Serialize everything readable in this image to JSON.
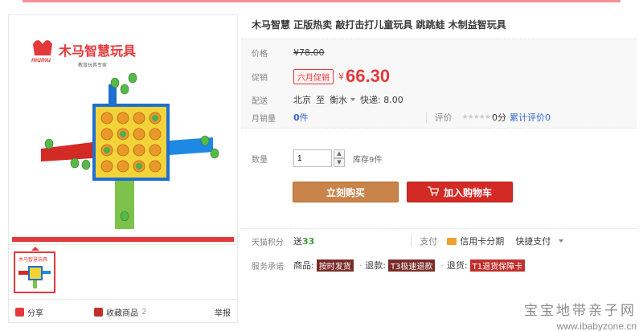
{
  "colors": {
    "accent": "#e4393c",
    "buy": "#c8844a",
    "cart": "#d42a26",
    "link": "#3366cc",
    "points": "#3a9a3a"
  },
  "product": {
    "title": "木马智慧 正版热卖 敲打击打儿童玩具 跳跳蛙 木制益智玩具",
    "image_logo": "木马智慧玩具",
    "image_logo_sub": "教育玩具专家",
    "image_brand": "mumu"
  },
  "price": {
    "label": "价格",
    "original": "¥78.00",
    "promo_label": "促销",
    "promo_tag": "六月促销",
    "currency": "¥",
    "current": "66.30"
  },
  "delivery": {
    "label": "配送",
    "from": "北京",
    "to_word": "至",
    "dest": "衡水",
    "express": "快递: 8.00"
  },
  "sales": {
    "label": "月销量",
    "count": "0",
    "unit": "件",
    "rating_label": "评价",
    "stars": "★★★★★",
    "score": "0分",
    "total_reviews": "累计评价0"
  },
  "quantity": {
    "label": "数量",
    "value": "1",
    "stock": "库存9件",
    "up": "▲",
    "down": "▼"
  },
  "buttons": {
    "buy": "立刻购买",
    "cart": "加入购物车"
  },
  "points": {
    "label": "天猫积分",
    "text": "送",
    "value": "33",
    "pay_label": "支付",
    "credit": "信用卡分期",
    "quick": "快捷支付"
  },
  "service": {
    "label": "服务承诺",
    "goods": "商品:",
    "goods_tag": "按时发货",
    "refund": "退款:",
    "refund_tag": "T3极速退款",
    "return": "退货:",
    "return_tag": "T1退货保障卡"
  },
  "gallery_actions": {
    "share": "分享",
    "favorite": "收藏商品",
    "favorite_count": "2",
    "report": "举报"
  },
  "watermark": {
    "line1": "宝宝地带亲子网",
    "line2": "www.ibabyzone.cn"
  }
}
